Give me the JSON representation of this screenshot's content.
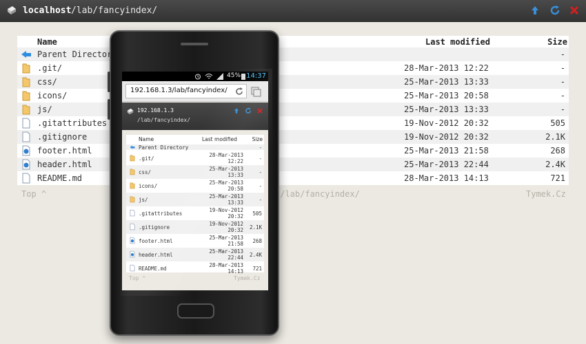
{
  "header": {
    "host": "localhost",
    "path": "/lab/fancyindex/",
    "icons": [
      "page-logo-icon",
      "arrow-up-icon",
      "refresh-icon",
      "close-x-icon"
    ],
    "colors": {
      "bar": "#3b3b3b",
      "accent": "#3a8fd8",
      "close": "#d22020"
    }
  },
  "listing": {
    "columns": {
      "name": "Name",
      "modified": "Last modified",
      "size": "Size"
    },
    "rows": [
      {
        "name": "Parent Directory",
        "modified": "",
        "size": "-",
        "icon": "back-arrow-icon"
      },
      {
        "name": ".git/",
        "modified": "28-Mar-2013 12:22",
        "size": "-",
        "icon": "folder-icon"
      },
      {
        "name": "css/",
        "modified": "25-Mar-2013 13:33",
        "size": "-",
        "icon": "folder-icon"
      },
      {
        "name": "icons/",
        "modified": "25-Mar-2013 20:58",
        "size": "-",
        "icon": "folder-icon"
      },
      {
        "name": "js/",
        "modified": "25-Mar-2013 13:33",
        "size": "-",
        "icon": "folder-icon"
      },
      {
        "name": ".gitattributes",
        "modified": "19-Nov-2012 20:32",
        "size": "505",
        "icon": "file-icon"
      },
      {
        "name": ".gitignore",
        "modified": "19-Nov-2012 20:32",
        "size": "2.1K",
        "icon": "file-icon"
      },
      {
        "name": "footer.html",
        "modified": "25-Mar-2013 21:58",
        "size": "268",
        "icon": "html-file-icon"
      },
      {
        "name": "header.html",
        "modified": "25-Mar-2013 22:44",
        "size": "2.4K",
        "icon": "html-file-icon"
      },
      {
        "name": "README.md",
        "modified": "28-Mar-2013 14:13",
        "size": "721",
        "icon": "file-icon"
      }
    ]
  },
  "footer": {
    "top_link": "Top ^",
    "path_fragment": "t/lab/fancyindex/",
    "credit": "Tymek.Cz"
  },
  "phone": {
    "status": {
      "battery": "45%",
      "time": "14:37"
    },
    "url": "192.168.1.3/lab/fancyindex/",
    "header": {
      "host": "192.168.1.3",
      "path": "/lab/fancyindex/"
    },
    "columns": {
      "name": "Name",
      "modified": "Last modified",
      "size": "Size"
    },
    "rows": [
      {
        "name": "Parent Directory",
        "modified": "",
        "size": "-"
      },
      {
        "name": ".git/",
        "modified": "28-Mar-2013 12:22",
        "size": "-"
      },
      {
        "name": "css/",
        "modified": "25-Mar-2013 13:33",
        "size": "-"
      },
      {
        "name": "icons/",
        "modified": "25-Mar-2013 20:58",
        "size": "-"
      },
      {
        "name": "js/",
        "modified": "25-Mar-2013 13:33",
        "size": "-"
      },
      {
        "name": ".gitattributes",
        "modified": "19-Nov-2012 20:32",
        "size": "505"
      },
      {
        "name": ".gitignore",
        "modified": "19-Nov-2012 20:32",
        "size": "2.1K"
      },
      {
        "name": "footer.html",
        "modified": "25-Mar-2013 21:58",
        "size": "268"
      },
      {
        "name": "header.html",
        "modified": "25-Mar-2013 22:44",
        "size": "2.4K"
      },
      {
        "name": "README.md",
        "modified": "28-Mar-2013 14:13",
        "size": "721"
      }
    ],
    "footer": {
      "top_link": "Top ^",
      "credit": "Tymek.Cz"
    }
  }
}
